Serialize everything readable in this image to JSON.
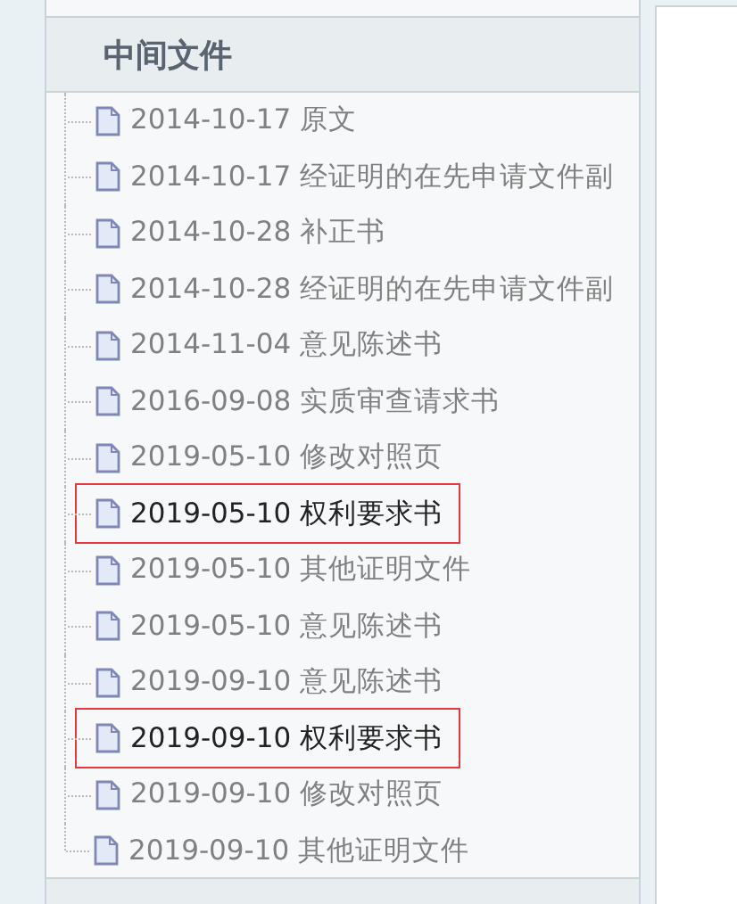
{
  "section": {
    "title": "中间文件"
  },
  "files": [
    {
      "label": "2014-10-17 原文",
      "highlighted": false
    },
    {
      "label": "2014-10-17 经证明的在先申请文件副",
      "highlighted": false
    },
    {
      "label": "2014-10-28 补正书",
      "highlighted": false
    },
    {
      "label": "2014-10-28 经证明的在先申请文件副",
      "highlighted": false
    },
    {
      "label": "2014-11-04 意见陈述书",
      "highlighted": false
    },
    {
      "label": "2016-09-08 实质审查请求书",
      "highlighted": false
    },
    {
      "label": "2019-05-10 修改对照页",
      "highlighted": false
    },
    {
      "label": "2019-05-10 权利要求书",
      "highlighted": true
    },
    {
      "label": "2019-05-10 其他证明文件",
      "highlighted": false
    },
    {
      "label": "2019-05-10 意见陈述书",
      "highlighted": false
    },
    {
      "label": "2019-09-10 意见陈述书",
      "highlighted": false
    },
    {
      "label": "2019-09-10 权利要求书",
      "highlighted": true
    },
    {
      "label": "2019-09-10 修改对照页",
      "highlighted": false
    },
    {
      "label": "2019-09-10 其他证明文件",
      "highlighted": false
    }
  ]
}
